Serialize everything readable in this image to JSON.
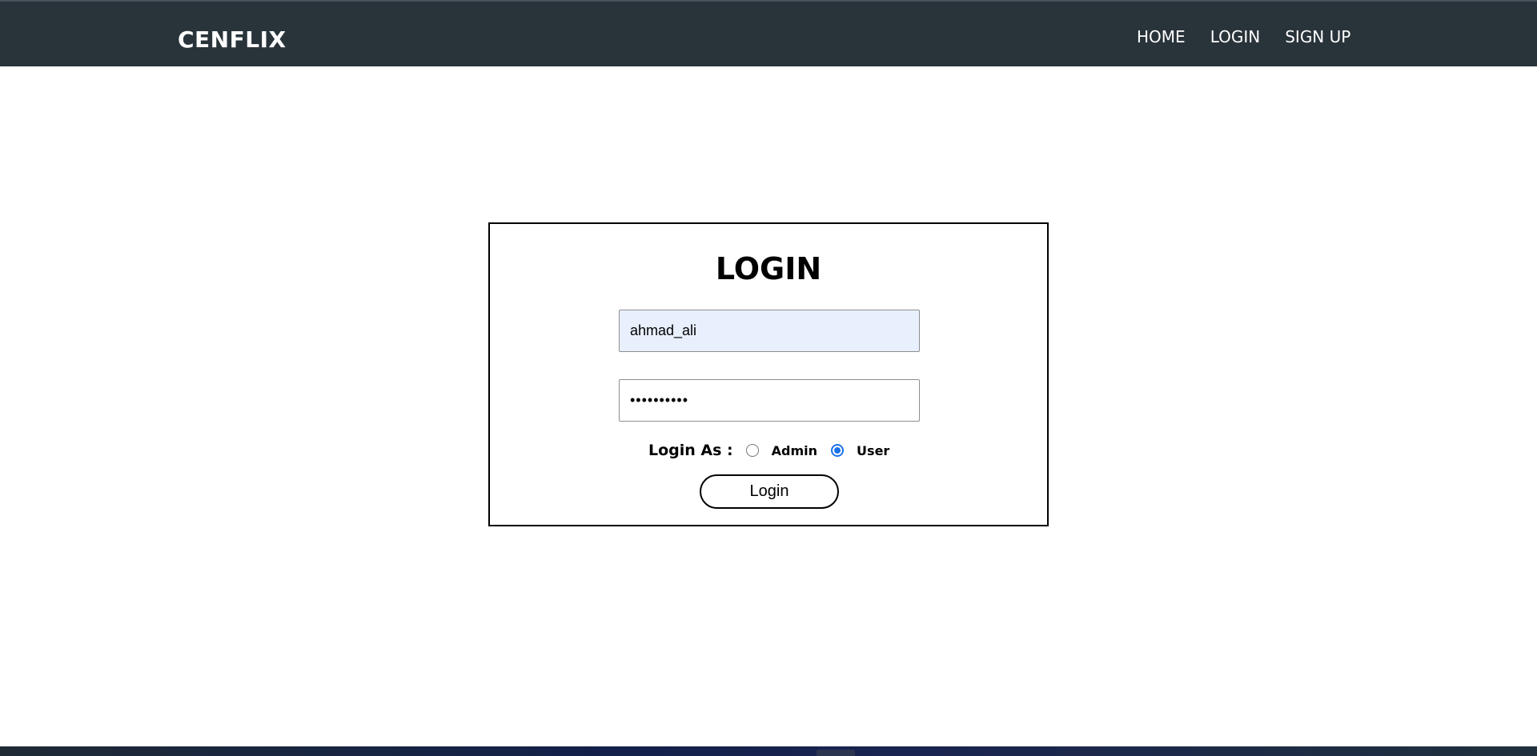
{
  "navbar": {
    "brand": "CENFLIX",
    "links": [
      {
        "label": "HOME"
      },
      {
        "label": "LOGIN"
      },
      {
        "label": "SIGN UP"
      }
    ]
  },
  "login": {
    "title": "LOGIN",
    "username_value": "ahmad_ali",
    "password_value": "••••••••••",
    "role_label": "Login As :",
    "roles": [
      {
        "label": "Admin",
        "checked": false
      },
      {
        "label": "User",
        "checked": true
      }
    ],
    "submit_label": "Login"
  },
  "colors": {
    "navbar_bg": "#29333a",
    "autofill_bg": "#e8f0fe",
    "radio_checked": "#1a73e8"
  }
}
